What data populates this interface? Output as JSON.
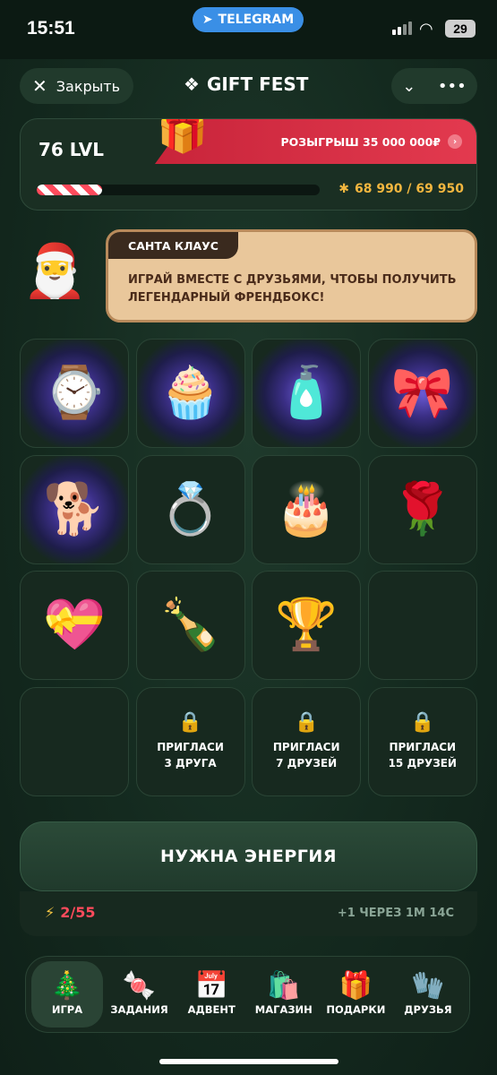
{
  "status": {
    "time": "15:51",
    "telegram": "TELEGRAM",
    "battery": "29"
  },
  "header": {
    "close_label": "Закрыть",
    "brand": "GIFT FEST"
  },
  "level": {
    "lvl": "76 LVL",
    "raffle": "РОЗЫГРЫШ 35 000 000₽",
    "xp": "68 990 / 69 950",
    "progress": 0.23
  },
  "santa": {
    "title": "САНТА КЛАУС",
    "text": "ИГРАЙ ВМЕСТЕ С ДРУЗЬЯМИ, ЧТОБЫ ПОЛУЧИТЬ ЛЕГЕНДАРНЫЙ ФРЕНДБОКС!"
  },
  "items": [
    {
      "icon": "⌚",
      "name": "watch-item",
      "rays": true
    },
    {
      "icon": "🧁",
      "name": "cocoa-cup-item",
      "rays": true
    },
    {
      "icon": "🧴",
      "name": "perfume-item",
      "rays": true
    },
    {
      "icon": "🎀",
      "name": "amulet-item",
      "rays": true
    },
    {
      "icon": "🐕",
      "name": "dog-item",
      "rays": true
    },
    {
      "icon": "💍",
      "name": "ring-item",
      "rays": false
    },
    {
      "icon": "🎂",
      "name": "cake-item",
      "rays": false
    },
    {
      "icon": "🌹",
      "name": "rose-item",
      "rays": false
    },
    {
      "icon": "💝",
      "name": "heart-item",
      "rays": false
    },
    {
      "icon": "🍾",
      "name": "champagne-item",
      "rays": false
    },
    {
      "icon": "🏆",
      "name": "trophy-item",
      "rays": false
    },
    {
      "icon": "",
      "name": "empty-slot",
      "rays": false
    },
    {
      "icon": "",
      "name": "empty-slot",
      "rays": false
    }
  ],
  "invites": [
    {
      "line1": "ПРИГЛАСИ",
      "line2": "3 ДРУГА"
    },
    {
      "line1": "ПРИГЛАСИ",
      "line2": "7 ДРУЗЕЙ"
    },
    {
      "line1": "ПРИГЛАСИ",
      "line2": "15 ДРУЗЕЙ"
    }
  ],
  "energy": {
    "button": "НУЖНА ЭНЕРГИЯ",
    "value": "2/55",
    "timer": "+1 ЧЕРЕЗ 1М 14С"
  },
  "nav": [
    {
      "icon": "🎄",
      "label": "ИГРА",
      "active": true,
      "name": "nav-game"
    },
    {
      "icon": "🍬",
      "label": "ЗАДАНИЯ",
      "active": false,
      "name": "nav-tasks"
    },
    {
      "icon": "📅",
      "label": "АДВЕНТ",
      "active": false,
      "name": "nav-advent"
    },
    {
      "icon": "🛍️",
      "label": "МАГАЗИН",
      "active": false,
      "name": "nav-shop"
    },
    {
      "icon": "🎁",
      "label": "ПОДАРКИ",
      "active": false,
      "name": "nav-gifts"
    },
    {
      "icon": "🧤",
      "label": "ДРУЗЬЯ",
      "active": false,
      "name": "nav-friends"
    }
  ]
}
